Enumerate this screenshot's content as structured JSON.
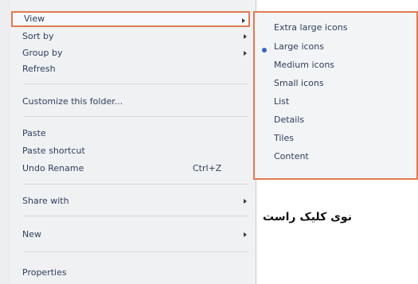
{
  "context_menu": {
    "items": [
      {
        "label": "View"
      },
      {
        "label": "Sort by"
      },
      {
        "label": "Group by"
      },
      {
        "label": "Refresh"
      },
      {
        "label": "Customize this folder..."
      },
      {
        "label": "Paste"
      },
      {
        "label": "Paste shortcut"
      },
      {
        "label": "Undo Rename",
        "shortcut": "Ctrl+Z"
      },
      {
        "label": "Share with"
      },
      {
        "label": "New"
      },
      {
        "label": "Properties"
      }
    ]
  },
  "view_submenu": {
    "selected": "Large icons",
    "items": [
      {
        "label": "Extra large icons"
      },
      {
        "label": "Large icons"
      },
      {
        "label": "Medium icons"
      },
      {
        "label": "Small icons"
      },
      {
        "label": "List"
      },
      {
        "label": "Details"
      },
      {
        "label": "Tiles"
      },
      {
        "label": "Content"
      }
    ]
  },
  "page_text": "نوی کلیک راست",
  "colors": {
    "highlight_border": "#e07a52",
    "radio_bullet": "#3b63b8",
    "menu_text": "#2d3f5c"
  }
}
